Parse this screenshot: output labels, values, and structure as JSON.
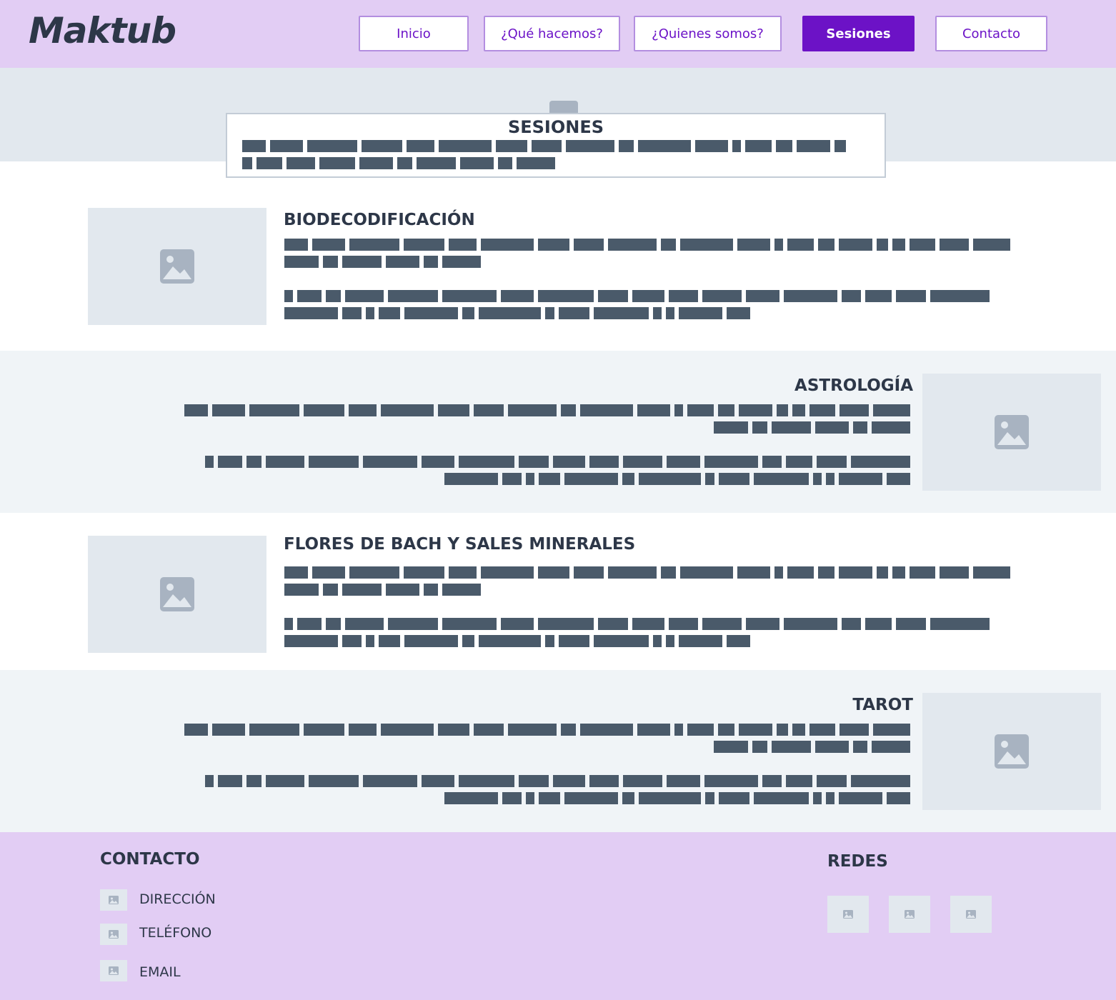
{
  "header": {
    "logo": "Maktub",
    "nav": [
      {
        "label": "Inicio",
        "active": false
      },
      {
        "label": "¿Qué hacemos?",
        "active": false
      },
      {
        "label": "¿Quienes somos?",
        "active": false
      },
      {
        "label": "Sesiones",
        "active": true
      },
      {
        "label": "Contacto",
        "active": false
      }
    ]
  },
  "hero": {
    "title": "SESIONES"
  },
  "sections": [
    {
      "title": "BIODECODIFICACIÓN",
      "image": "image-placeholder-icon"
    },
    {
      "title": "ASTROLOGÍA",
      "image": "image-placeholder-icon"
    },
    {
      "title": "FLORES DE BACH Y SALES MINERALES",
      "image": "image-placeholder-icon"
    },
    {
      "title": "TAROT",
      "image": "image-placeholder-icon"
    }
  ],
  "footer": {
    "contact_title": "CONTACTO",
    "contact_items": [
      {
        "label": "DIRECCIÓN",
        "icon": "image-placeholder-icon"
      },
      {
        "label": "TELÉFONO",
        "icon": "image-placeholder-icon"
      },
      {
        "label": "EMAIL",
        "icon": "image-placeholder-icon"
      }
    ],
    "social_title": "REDES",
    "social_icons": [
      "image-placeholder-icon",
      "image-placeholder-icon",
      "image-placeholder-icon"
    ]
  },
  "colors": {
    "header_bg": "#e2cdf4",
    "accent": "#6c12c6",
    "text": "#2d3748",
    "placeholder_text": "#4a5a6a",
    "image_placeholder": "#e2e8ee",
    "alt_band": "#f0f4f7"
  }
}
